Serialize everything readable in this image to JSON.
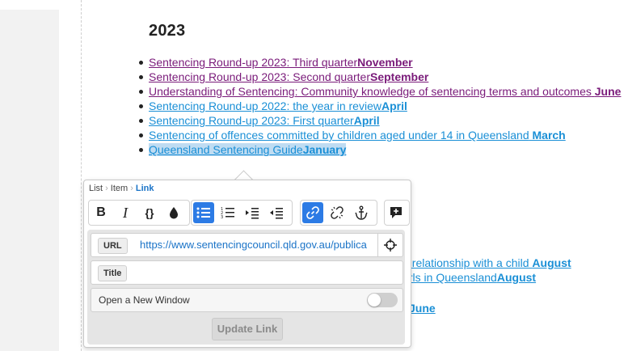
{
  "heading": "2023",
  "list_items": [
    {
      "title": "Sentencing Round-up 2023: Third quarter",
      "month": "November",
      "state": "visited",
      "spaced": false
    },
    {
      "title": "Sentencing Round-up 2023: Second quarter",
      "month": "September",
      "state": "visited",
      "spaced": false
    },
    {
      "title": "Understanding of Sentencing: Community knowledge of sentencing terms and outcomes",
      "month": "June",
      "state": "visited",
      "spaced": true
    },
    {
      "title": "Sentencing Round-up 2022: the year in review",
      "month": "April",
      "state": "unvisited",
      "spaced": false
    },
    {
      "title": "Sentencing Round-up 2023: First quarter",
      "month": "April",
      "state": "unvisited",
      "spaced": false
    },
    {
      "title": "Sentencing of offences committed by children aged under 14 in Queensland",
      "month": "March",
      "state": "unvisited",
      "spaced": true
    },
    {
      "title": "Queensland Sentencing Guide",
      "month": "January",
      "state": "selected",
      "spaced": false
    }
  ],
  "hidden_items": [
    {
      "title": "al relationship with a child",
      "month": "August"
    },
    {
      "title": "girls in Queensland",
      "month": "August"
    },
    {
      "title": "",
      "month": "June"
    }
  ],
  "breadcrumb": {
    "items": [
      "List",
      "Item"
    ],
    "active": "Link"
  },
  "toolbar": {
    "buttons": [
      "bold",
      "italic",
      "code",
      "color",
      "bulleted-list",
      "numbered-list",
      "indent",
      "outdent",
      "link",
      "unlink",
      "anchor",
      "comment"
    ]
  },
  "link_form": {
    "url_label": "URL",
    "url_value": "https://www.sentencingcouncil.qld.gov.au/publica",
    "title_label": "Title",
    "title_value": "",
    "new_window_label": "Open a New Window",
    "new_window_enabled": false,
    "submit_label": "Update Link"
  }
}
